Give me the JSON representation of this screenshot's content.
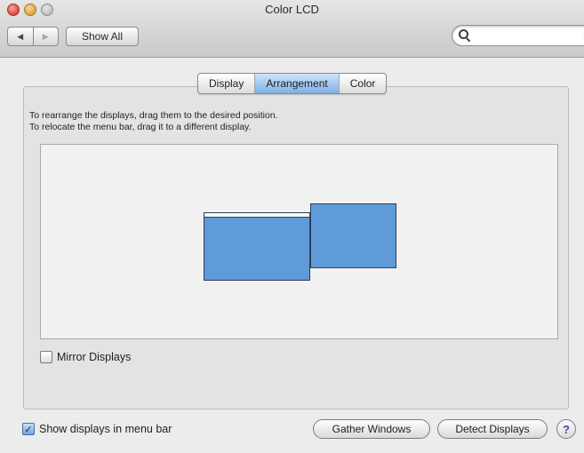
{
  "window": {
    "title": "Color LCD"
  },
  "toolbar": {
    "back_icon": "◀",
    "forward_icon": "▶",
    "show_all_label": "Show All",
    "search": {
      "value": "",
      "placeholder": ""
    }
  },
  "tabs": [
    {
      "label": "Display",
      "active": false
    },
    {
      "label": "Arrangement",
      "active": true
    },
    {
      "label": "Color",
      "active": false
    }
  ],
  "arrangement": {
    "instruction_1": "To rearrange the displays, drag them to the desired position.",
    "instruction_2": "To relocate the menu bar, drag it to a different display.",
    "mirror_label": "Mirror Displays",
    "mirror_checked": false
  },
  "footer": {
    "show_in_menu_bar_label": "Show displays in menu bar",
    "show_in_menu_bar_checked": true,
    "check_mark": "✓",
    "gather_windows_label": "Gather Windows",
    "detect_displays_label": "Detect Displays",
    "help_label": "?"
  },
  "colors": {
    "display_fill": "#5f9bd8",
    "active_tab": "#7fb0e6"
  }
}
